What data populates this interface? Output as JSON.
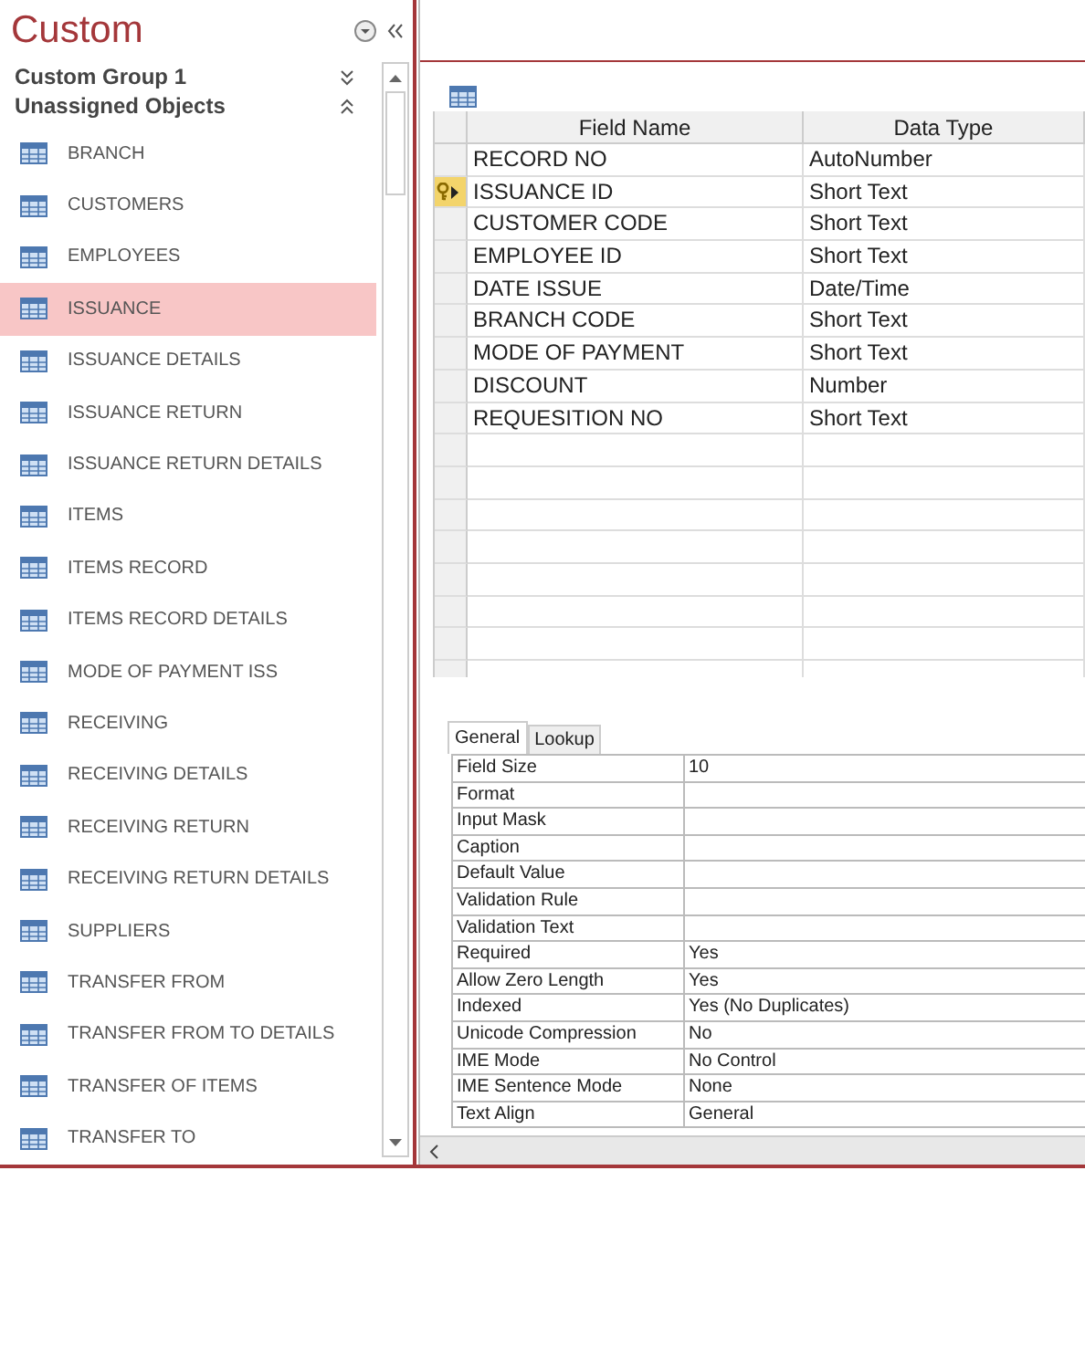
{
  "nav": {
    "title": "Custom",
    "groups": [
      {
        "label": "Custom Group 1",
        "expanded": false
      },
      {
        "label": "Unassigned Objects",
        "expanded": true
      }
    ],
    "items": [
      {
        "label": "BRANCH",
        "selected": false
      },
      {
        "label": "CUSTOMERS",
        "selected": false
      },
      {
        "label": "EMPLOYEES",
        "selected": false
      },
      {
        "label": "ISSUANCE",
        "selected": true
      },
      {
        "label": "ISSUANCE DETAILS",
        "selected": false
      },
      {
        "label": "ISSUANCE RETURN",
        "selected": false
      },
      {
        "label": "ISSUANCE RETURN DETAILS",
        "selected": false
      },
      {
        "label": "ITEMS",
        "selected": false
      },
      {
        "label": "ITEMS RECORD",
        "selected": false
      },
      {
        "label": "ITEMS RECORD DETAILS",
        "selected": false
      },
      {
        "label": "MODE OF PAYMENT ISS",
        "selected": false
      },
      {
        "label": "RECEIVING",
        "selected": false
      },
      {
        "label": "RECEIVING DETAILS",
        "selected": false
      },
      {
        "label": "RECEIVING RETURN",
        "selected": false
      },
      {
        "label": "RECEIVING RETURN DETAILS",
        "selected": false
      },
      {
        "label": "SUPPLIERS",
        "selected": false
      },
      {
        "label": "TRANSFER FROM",
        "selected": false
      },
      {
        "label": "TRANSFER FROM TO DETAILS",
        "selected": false
      },
      {
        "label": "TRANSFER OF ITEMS",
        "selected": false
      },
      {
        "label": "TRANSFER TO",
        "selected": false
      }
    ]
  },
  "design": {
    "columns": [
      "Field Name",
      "Data Type"
    ],
    "fields": [
      {
        "name": "RECORD NO",
        "type": "AutoNumber",
        "primary_key": false,
        "current": false
      },
      {
        "name": "ISSUANCE ID",
        "type": "Short Text",
        "primary_key": true,
        "current": true
      },
      {
        "name": "CUSTOMER CODE",
        "type": "Short Text",
        "primary_key": false,
        "current": false
      },
      {
        "name": "EMPLOYEE ID",
        "type": "Short Text",
        "primary_key": false,
        "current": false
      },
      {
        "name": "DATE ISSUE",
        "type": "Date/Time",
        "primary_key": false,
        "current": false
      },
      {
        "name": "BRANCH CODE",
        "type": "Short Text",
        "primary_key": false,
        "current": false
      },
      {
        "name": "MODE OF PAYMENT",
        "type": "Short Text",
        "primary_key": false,
        "current": false
      },
      {
        "name": "DISCOUNT",
        "type": "Number",
        "primary_key": false,
        "current": false
      },
      {
        "name": "REQUESITION NO",
        "type": "Short Text",
        "primary_key": false,
        "current": false
      }
    ]
  },
  "properties": {
    "tabs": [
      {
        "label": "General",
        "selected": true
      },
      {
        "label": "Lookup",
        "selected": false
      }
    ],
    "rows": [
      {
        "label": "Field Size",
        "value": "10"
      },
      {
        "label": "Format"
      },
      {
        "label": "Input Mask"
      },
      {
        "label": "Caption"
      },
      {
        "label": "Default Value"
      },
      {
        "label": "Validation Rule"
      },
      {
        "label": "Validation Text"
      },
      {
        "label": "Required",
        "value": "Yes"
      },
      {
        "label": "Allow Zero Length",
        "value": "Yes"
      },
      {
        "label": "Indexed",
        "value": "Yes (No Duplicates)"
      },
      {
        "label": "Unicode Compression",
        "value": "No"
      },
      {
        "label": "IME Mode",
        "value": "No Control"
      },
      {
        "label": "IME Sentence Mode",
        "value": "None"
      },
      {
        "label": "Text Align",
        "value": "General"
      }
    ]
  }
}
